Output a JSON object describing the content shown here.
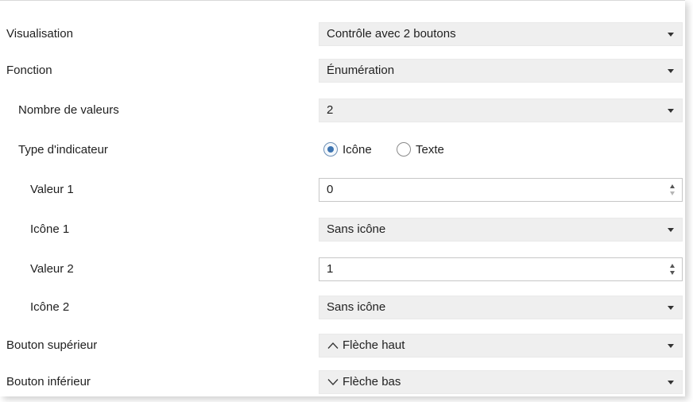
{
  "rows": {
    "visualisation": {
      "label": "Visualisation",
      "value": "Contrôle avec 2 boutons"
    },
    "fonction": {
      "label": "Fonction",
      "value": "Énumération"
    },
    "nombre_valeurs": {
      "label": "Nombre de valeurs",
      "value": "2"
    },
    "type_indicateur": {
      "label": "Type d'indicateur",
      "options": [
        "Icône",
        "Texte"
      ],
      "selected": "Icône"
    },
    "valeur1": {
      "label": "Valeur 1",
      "value": "0"
    },
    "icone1": {
      "label": "Icône 1",
      "value": "Sans icône"
    },
    "valeur2": {
      "label": "Valeur 2",
      "value": "1"
    },
    "icone2": {
      "label": "Icône 2",
      "value": "Sans icône"
    },
    "bouton_superieur": {
      "label": "Bouton supérieur",
      "value": "Flèche haut",
      "icon": "chevron-up-icon"
    },
    "bouton_inferieur": {
      "label": "Bouton inférieur",
      "value": "Flèche bas",
      "icon": "chevron-down-icon"
    }
  },
  "colors": {
    "select_bg": "#efefef",
    "radio_accent": "#3d74b1"
  }
}
